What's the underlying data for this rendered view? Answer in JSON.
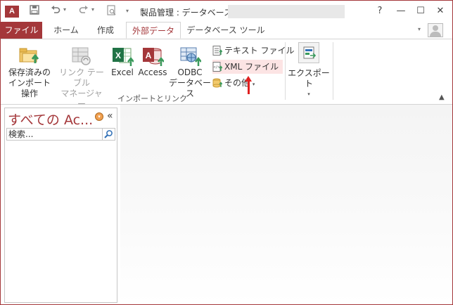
{
  "titlebar": {
    "app_icon": "A",
    "title": "製品管理 : データベース- ",
    "qat": {
      "save": "save-icon",
      "undo": "undo-icon",
      "redo": "redo-icon",
      "preview": "print-preview-icon"
    },
    "controls": {
      "help": "?",
      "minimize": "—",
      "maximize": "☐",
      "close": "✕"
    }
  },
  "tabs": [
    {
      "label": "ファイル",
      "state": "file"
    },
    {
      "label": "ホーム",
      "state": "normal"
    },
    {
      "label": "作成",
      "state": "normal"
    },
    {
      "label": "外部データ",
      "state": "active"
    },
    {
      "label": "データベース ツール",
      "state": "normal"
    }
  ],
  "ribbon": {
    "import_group": {
      "label": "インポートとリンク",
      "saved_imports": {
        "line1": "保存済みの",
        "line2": "インポート操作"
      },
      "linked_table_manager": {
        "line1": "リンク テーブル",
        "line2": "マネージャー"
      },
      "excel": "Excel",
      "access": "Access",
      "odbc": {
        "line1": "ODBC",
        "line2": "データベース"
      },
      "text_file": "テキスト ファイル",
      "xml_file": "XML ファイル",
      "more": "その他"
    },
    "export_group": {
      "export": "エクスポート"
    }
  },
  "nav_pane": {
    "title": "すべての Ac...",
    "search_placeholder": "検索..."
  },
  "colors": {
    "accent": "#a4373a",
    "highlight": "#fce4e4",
    "annotation_arrow": "#e02020"
  }
}
